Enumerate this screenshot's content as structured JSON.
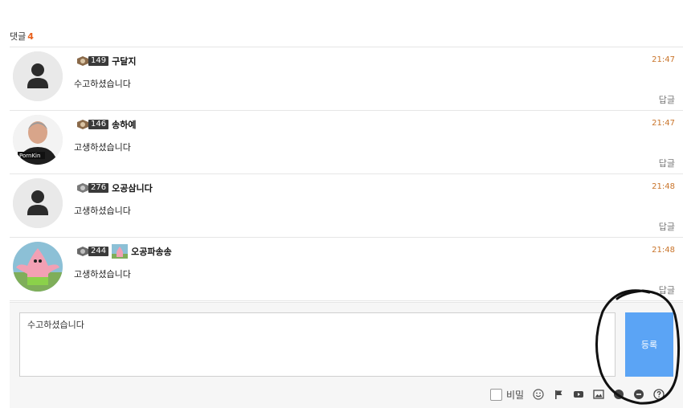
{
  "header": {
    "label": "댓글",
    "count": "4"
  },
  "comments": [
    {
      "level": "149",
      "nickname": "구달지",
      "time": "21:47",
      "text": "수고하셨습니다",
      "reply": "답글",
      "avatar": "default-avatar"
    },
    {
      "level": "146",
      "nickname": "송하예",
      "time": "21:47",
      "text": "고생하셨습니다",
      "reply": "답글",
      "avatar": "photo-avatar",
      "avatar_text": "PornKin"
    },
    {
      "level": "276",
      "nickname": "오공삼니다",
      "time": "21:48",
      "text": "고생하셨습니다",
      "reply": "답글",
      "avatar": "default-avatar"
    },
    {
      "level": "244",
      "nickname": "오공파송송",
      "time": "21:48",
      "text": "고생하셨습니다",
      "reply": "답글",
      "avatar": "patrick-avatar"
    }
  ],
  "write": {
    "value": "수고하셨습니다",
    "submit_label": "등록",
    "secret_label": "비밀",
    "tools": [
      "emoji-icon",
      "flag-icon",
      "video-icon",
      "image-icon",
      "info-icon",
      "minus-circle-icon",
      "help-icon"
    ]
  },
  "colors": {
    "accent": "#5ba4f5",
    "count": "#e8601c",
    "time": "#c9742a"
  }
}
